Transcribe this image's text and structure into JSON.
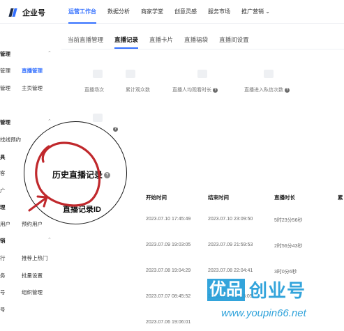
{
  "topbar": {
    "logo_text": "企业号",
    "nav": [
      {
        "label": "运营工作台",
        "active": true
      },
      {
        "label": "数据分析",
        "active": false
      },
      {
        "label": "商家学堂",
        "active": false
      },
      {
        "label": "创意灵感",
        "active": false
      },
      {
        "label": "服务市场",
        "active": false
      },
      {
        "label": "推广营销 ⌄",
        "active": false
      }
    ]
  },
  "sidebar": {
    "items": [
      {
        "label": "管理",
        "kind": "group"
      },
      {
        "label": "管理",
        "kind": "item"
      },
      {
        "label": "直播管理",
        "kind": "active"
      },
      {
        "label": "主页管理",
        "kind": "item"
      },
      {
        "label": "管理",
        "kind": "item"
      },
      {
        "label": "管理",
        "kind": "group"
      },
      {
        "label": "找线预约",
        "kind": "item"
      },
      {
        "label": "具",
        "kind": "group"
      },
      {
        "label": "客",
        "kind": "item"
      },
      {
        "label": "广",
        "kind": "item"
      },
      {
        "label": "理",
        "kind": "group"
      },
      {
        "label": "用户",
        "kind": "item"
      },
      {
        "label": "预约用户",
        "kind": "item"
      },
      {
        "label": "销",
        "kind": "group"
      },
      {
        "label": "行",
        "kind": "item"
      },
      {
        "label": "推荐上热门",
        "kind": "item"
      },
      {
        "label": "务",
        "kind": "item"
      },
      {
        "label": "批量设置",
        "kind": "item"
      },
      {
        "label": "号",
        "kind": "item"
      },
      {
        "label": "组织管理",
        "kind": "item"
      },
      {
        "label": "号",
        "kind": "item"
      }
    ],
    "chevron": "⌃"
  },
  "tabs": [
    {
      "label": "当前直播管理",
      "active": false
    },
    {
      "label": "直播记录",
      "active": true
    },
    {
      "label": "直播卡片",
      "active": false
    },
    {
      "label": "直播福袋",
      "active": false
    },
    {
      "label": "直播间设置",
      "active": false
    }
  ],
  "stats": [
    {
      "label": "直播场次"
    },
    {
      "label": "累计观众数"
    },
    {
      "label": "直播人均观看时长",
      "help": "?"
    },
    {
      "label": "直播进入私信次数",
      "help": "?"
    }
  ],
  "lens": {
    "title": "历史直播记录",
    "help": "?",
    "subtitle": "直播记录ID"
  },
  "table": {
    "headers": [
      "开始时间",
      "结束时间",
      "直播时长",
      "累"
    ],
    "rows": [
      {
        "start": "2023.07.10 17:45:49",
        "end": "2023.07.10 23:09:50",
        "duration": "5时23分56秒"
      },
      {
        "start": "2023.07.09 19:03:05",
        "end": "2023.07.09 21:59:53",
        "duration": "2时56分43秒"
      },
      {
        "start": "2023.07.08 19:04:29",
        "end": "2023.07.08 22:04:41",
        "duration": "3时0分6秒"
      },
      {
        "start": "2023.07.07 08:45:52",
        "end": "2023.07.07 11:13:05",
        "duration": ""
      },
      {
        "start": "2023.07.06 19:06:01",
        "end": "",
        "duration": ""
      }
    ]
  },
  "watermark": {
    "box_text": "优品",
    "rest_text": "创业号",
    "url": "www.youpin66.net"
  },
  "colors": {
    "accent": "#3370ff",
    "annotation": "#c0282c",
    "watermark": "#1d9bd8"
  }
}
